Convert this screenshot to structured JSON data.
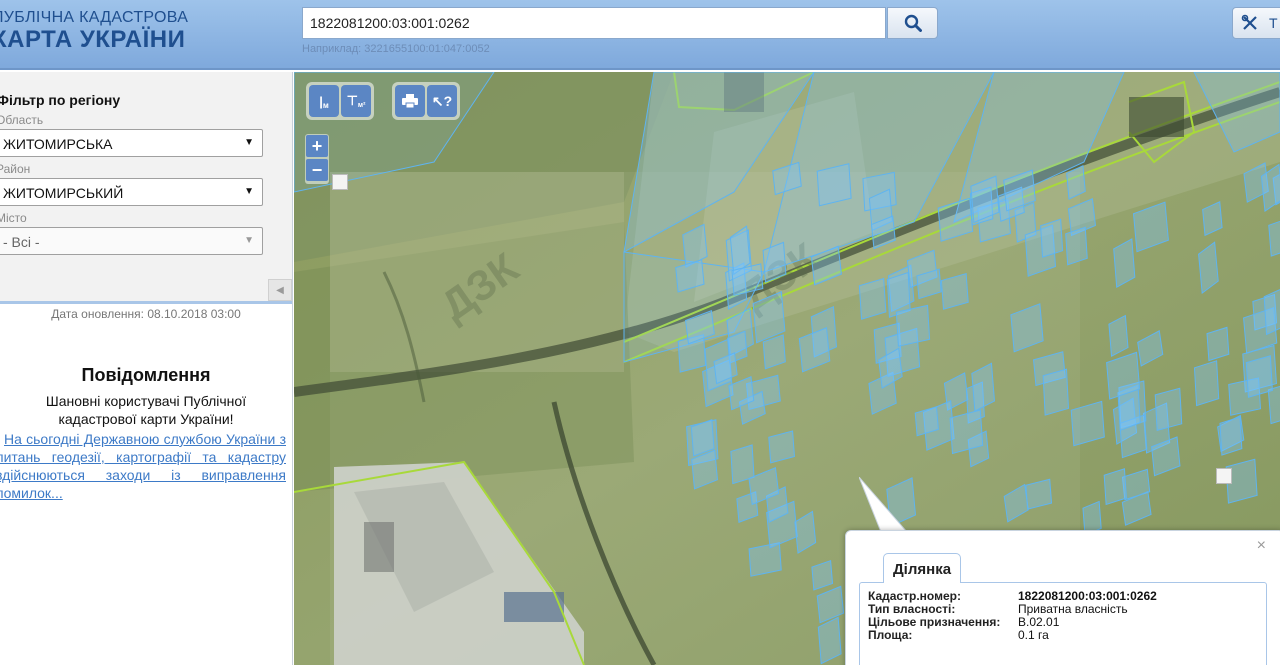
{
  "header": {
    "logo_line1": "ПУБЛІЧНА КАДАСТРОВА",
    "logo_line2": "КАРТА УКРАЇНИ",
    "search_value": "1822081200:03:001:0262",
    "search_hint": "Наприклад: 3221655100:01:047:0052",
    "tools_label": "Т"
  },
  "sidebar": {
    "filter_title": "Фільтр по регіону",
    "region_label": "Область",
    "region_value": "ЖИТОМИРСЬКА",
    "district_label": "Район",
    "district_value": "ЖИТОМИРСЬКИЙ",
    "city_label": "Місто",
    "city_value": "- Всі -",
    "update_date": "Дата оновлення: 08.10.2018 03:00",
    "notice_title": "Повідомлення",
    "notice_greeting": "Шановні користувачі Публічної кадастрової карти України!",
    "notice_link": "На сьогодні Державною службою України з питань геодезії, картографії та кадастру здійснюються заходи із виправлення помилок..."
  },
  "map": {
    "tools": {
      "ruler": "м",
      "area": "м²"
    },
    "zoom_in": "+",
    "zoom_out": "−",
    "watermark": "ДЗК"
  },
  "popup": {
    "tab": "Ділянка",
    "close": "×",
    "rows": [
      {
        "key": "Кадастр.номер:",
        "value": "1822081200:03:001:0262"
      },
      {
        "key": "Тип власності:",
        "value": "Приватна власність"
      },
      {
        "key": "Цільове призначення:",
        "value": "В.02.01"
      },
      {
        "key": "Площа:",
        "value": "0.1 га"
      }
    ]
  },
  "colors": {
    "accent": "#5b86c4",
    "parcel_outline": "#5fb4f0",
    "boundary": "#a8d93a",
    "link": "#3d7ac7"
  }
}
